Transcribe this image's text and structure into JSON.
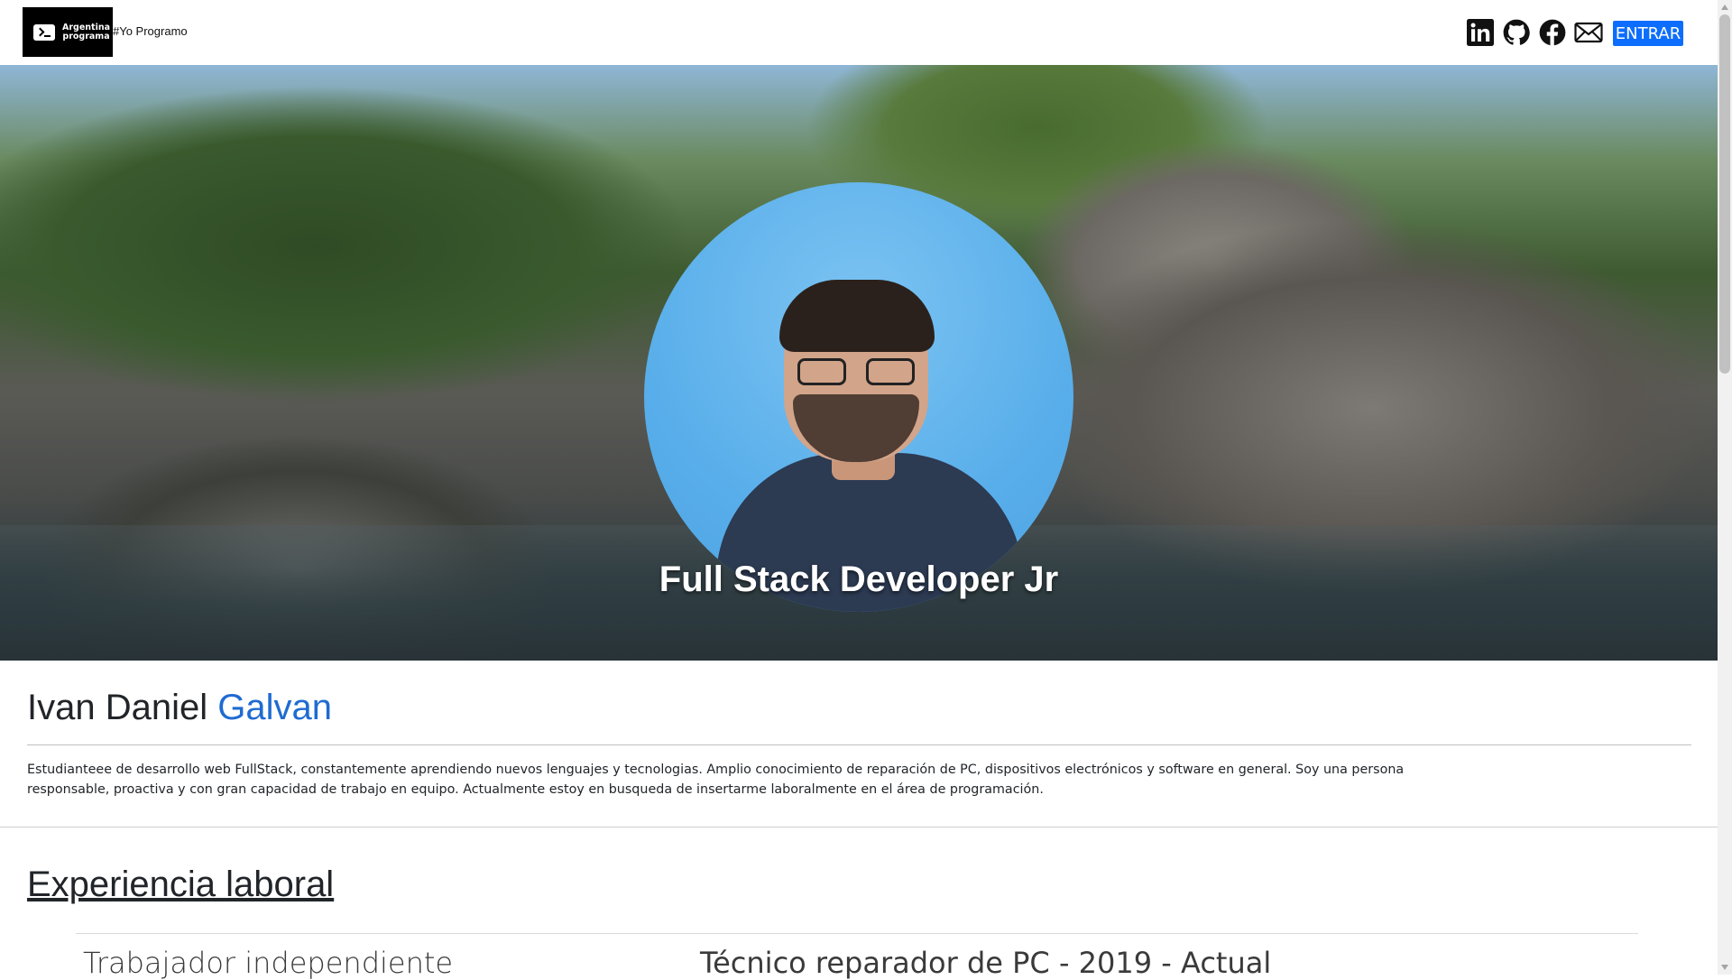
{
  "header": {
    "logo_line1": "Argentina",
    "logo_line2": "programa",
    "tagline": "#Yo Programo",
    "social_icons": [
      "linkedin-icon",
      "github-icon",
      "facebook-icon",
      "mail-icon"
    ],
    "enter_label": "ENTRAR",
    "accent_color": "#0d6efd"
  },
  "hero": {
    "title": "Full Stack Developer Jr"
  },
  "about": {
    "first_name": "Ivan Daniel",
    "last_name": "Galvan",
    "last_name_color": "#1f6bd1",
    "bio": "Estudianteee de desarrollo web FullStack, constantemente aprendiendo nuevos lenguajes y tecnologias. Amplio conocimiento de reparación de PC, dispositivos electrónicos y software en general. Soy una persona responsable, proactiva y con gran capacidad de trabajo en equipo. Actualmente estoy en busqueda de insertarme laboralmente en el área de programación."
  },
  "experience": {
    "title": "Experiencia laboral",
    "jobs": [
      {
        "company": "Trabajador independiente",
        "role": "Técnico reparador de PC - 2019 - Actual"
      }
    ]
  }
}
